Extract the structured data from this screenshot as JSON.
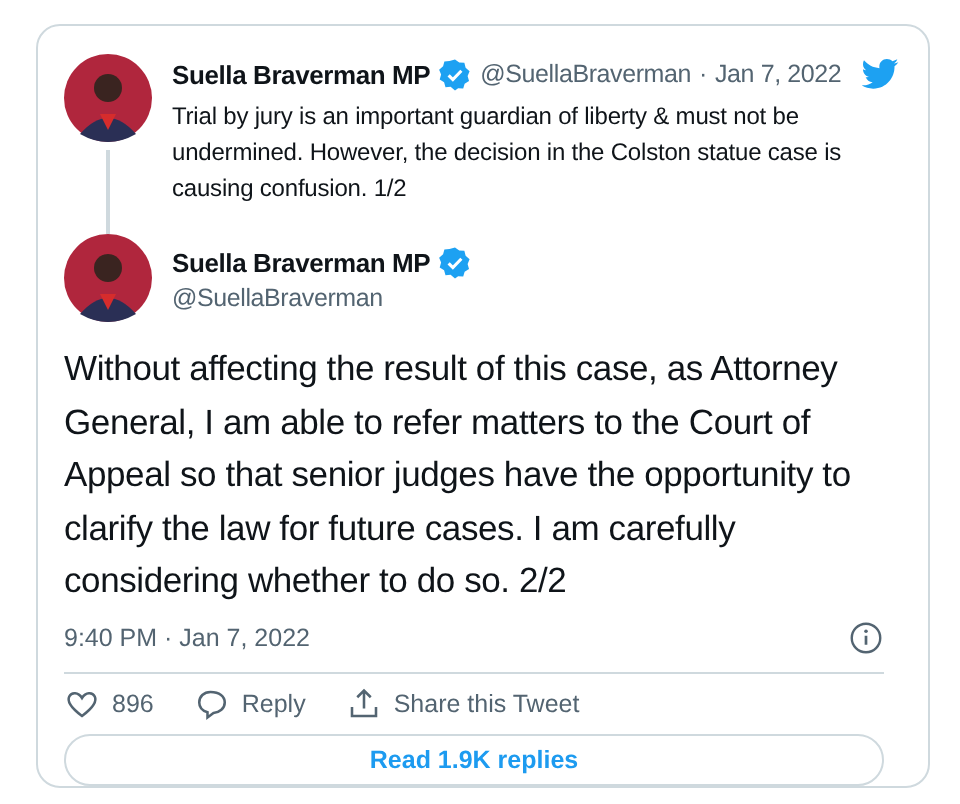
{
  "quoted_tweet": {
    "author": "Suella Braverman MP",
    "verified": true,
    "handle": "@SuellaBraverman",
    "separator": "·",
    "date": "Jan 7, 2022",
    "text": "Trial by jury is an important guardian of liberty & must not be undermined. However, the decision in the Colston statue case is causing confusion. 1/2"
  },
  "tweet": {
    "author": "Suella Braverman MP",
    "verified": true,
    "handle": "@SuellaBraverman",
    "text": "Without affecting the result of this case, as Attorney General, I am able to refer matters to the Court of Appeal so that senior judges have the opportunity to clarify the law for future cases. I am carefully considering whether to do so. 2/2",
    "timestamp": "9:40 PM · Jan 7, 2022"
  },
  "actions": [
    {
      "kind": "like",
      "label": "896"
    },
    {
      "kind": "reply",
      "label": "Reply"
    },
    {
      "kind": "share",
      "label": "Share this Tweet"
    }
  ],
  "read_replies_button": "Read 1.9K replies"
}
